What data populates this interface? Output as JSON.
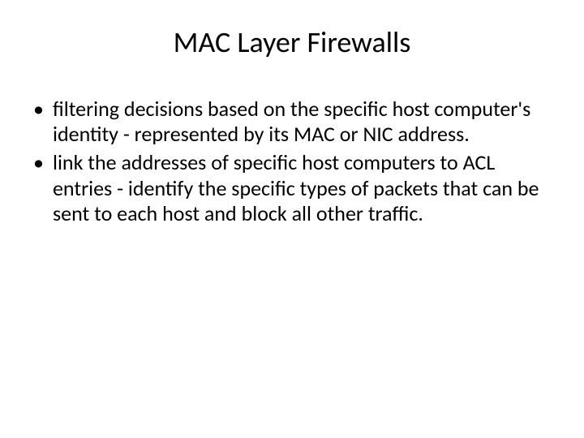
{
  "slide": {
    "title": "MAC Layer Firewalls",
    "bullets": [
      "filtering decisions based on the specific host computer's identity - represented by its MAC or NIC address.",
      "link the addresses of specific host computers to ACL entries - identify the specific types of packets that can be sent to each host and block all other traffic."
    ]
  }
}
